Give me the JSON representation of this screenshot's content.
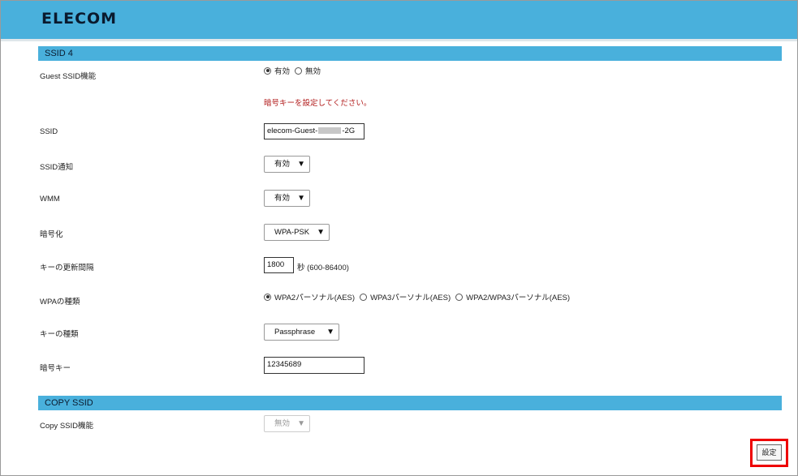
{
  "header": {
    "logo": "ELECOM",
    "brand_color": "#49b0dc"
  },
  "ssid4": {
    "title": "SSID 4",
    "guest_label": "Guest SSID機能",
    "guest_options": [
      "有効",
      "無効"
    ],
    "guest_selected": "有効",
    "warning": "暗号キーを設定してください。",
    "ssid_label": "SSID",
    "ssid_prefix": "elecom-Guest-",
    "ssid_suffix": "-2G",
    "broadcast_label": "SSID通知",
    "broadcast_value": "有効",
    "wmm_label": "WMM",
    "wmm_value": "有効",
    "encryption_label": "暗号化",
    "encryption_value": "WPA-PSK",
    "interval_label": "キーの更新間隔",
    "interval_value": "1800",
    "interval_unit": "秒 (600-86400)",
    "wpa_type_label": "WPAの種類",
    "wpa_options": [
      "WPA2パーソナル(AES)",
      "WPA3パーソナル(AES)",
      "WPA2/WPA3パーソナル(AES)"
    ],
    "wpa_selected": "WPA2パーソナル(AES)",
    "key_type_label": "キーの種類",
    "key_type_value": "Passphrase",
    "key_label": "暗号キー",
    "key_value": "12345689"
  },
  "copy_ssid": {
    "title": "COPY SSID",
    "label": "Copy SSID機能",
    "value": "無効"
  },
  "actions": {
    "set_label": "設定",
    "highlight_color": "#ee0000"
  }
}
